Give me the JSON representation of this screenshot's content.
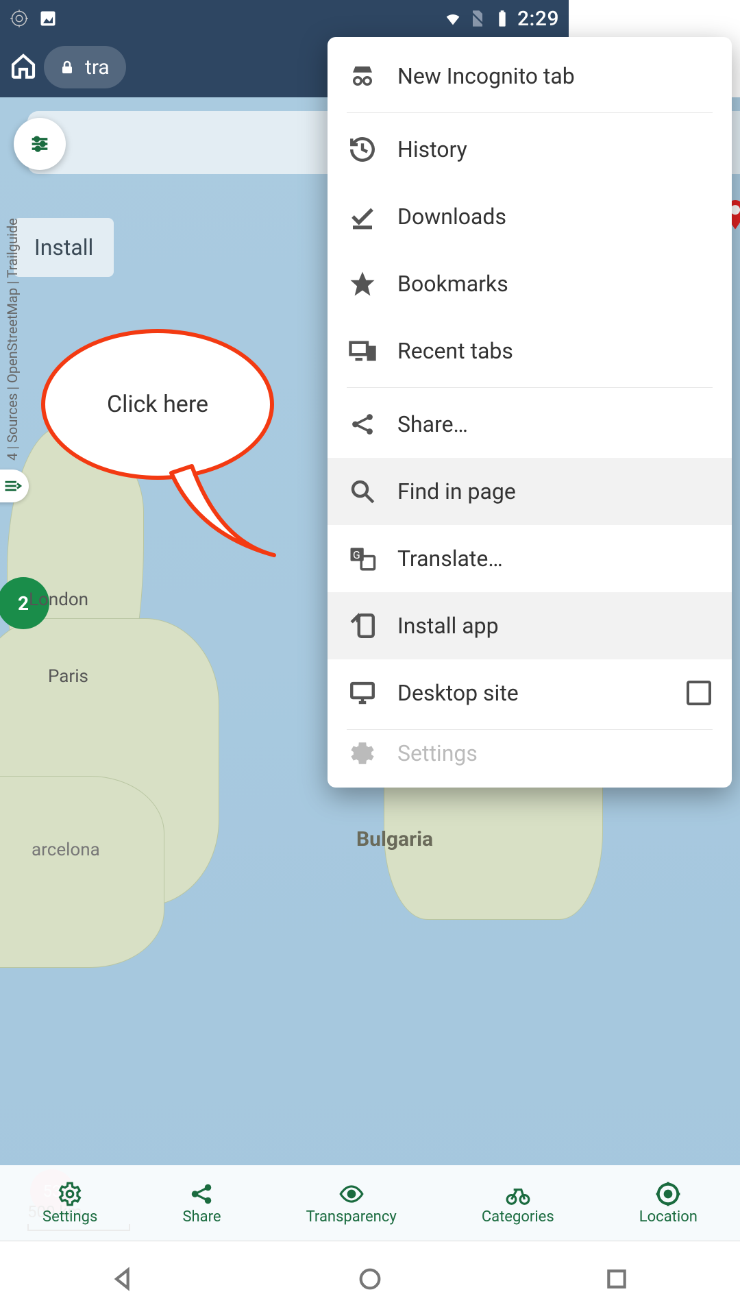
{
  "statusbar": {
    "time": "2:29"
  },
  "browser": {
    "url_fragment": "tra"
  },
  "map": {
    "city_london": "London",
    "city_paris": "Paris",
    "city_barcelona": "arcelona",
    "region_bulgaria": "Bulgaria",
    "scale_label": "500 km",
    "attribution": "4 | Sources | OpenStreetMap | Trailguide",
    "cluster_value": "2",
    "pink_cluster": "53",
    "install_chip": "Install"
  },
  "bottombar": {
    "settings": "Settings",
    "share": "Share",
    "transparency": "Transparency",
    "categories": "Categories",
    "location": "Location"
  },
  "menu": {
    "incognito": "New Incognito tab",
    "history": "History",
    "downloads": "Downloads",
    "bookmarks": "Bookmarks",
    "recent": "Recent tabs",
    "share": "Share…",
    "find": "Find in page",
    "translate": "Translate…",
    "install": "Install app",
    "desktop": "Desktop site",
    "settings": "Settings"
  },
  "callout": {
    "text": "Click here"
  }
}
